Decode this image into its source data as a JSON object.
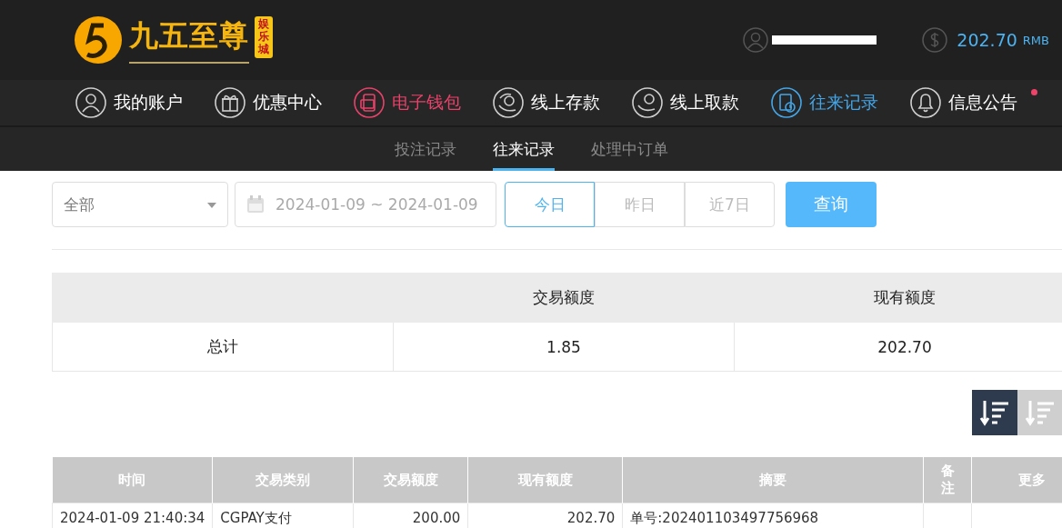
{
  "header": {
    "logo_title": "九五至尊",
    "logo_badge": "娱乐城",
    "balance": "202.70",
    "currency": "RMB"
  },
  "nav": [
    {
      "label": "我的账户",
      "color": "#ffffff",
      "dot": false
    },
    {
      "label": "优惠中心",
      "color": "#ffffff",
      "dot": false
    },
    {
      "label": "电子钱包",
      "color": "#e8426a",
      "dot": false
    },
    {
      "label": "线上存款",
      "color": "#ffffff",
      "dot": false
    },
    {
      "label": "线上取款",
      "color": "#ffffff",
      "dot": false
    },
    {
      "label": "往来记录",
      "color": "#44a6e8",
      "dot": false
    },
    {
      "label": "信息公告",
      "color": "#ffffff",
      "dot": true
    }
  ],
  "subtabs": [
    {
      "label": "投注记录",
      "selected": false
    },
    {
      "label": "往来记录",
      "selected": true
    },
    {
      "label": "处理中订单",
      "selected": false
    }
  ],
  "filter": {
    "type_select": "全部",
    "date_range": "2024-01-09 ~ 2024-01-09",
    "quick": [
      {
        "label": "今日",
        "selected": true
      },
      {
        "label": "昨日",
        "selected": false
      },
      {
        "label": "近7日",
        "selected": false
      }
    ],
    "query_button": "查询"
  },
  "summary": {
    "columns": [
      "交易额度",
      "现有额度"
    ],
    "row": {
      "label": "总计",
      "values": [
        "1.85",
        "202.70"
      ]
    }
  },
  "sort_buttons": [
    {
      "selected": true
    },
    {
      "selected": false
    }
  ],
  "table": {
    "columns": [
      "时间",
      "交易类别",
      "交易额度",
      "现有额度",
      "摘要",
      "备注",
      "更多"
    ],
    "rows": [
      [
        "2024-01-09 21:40:34",
        "CGPAY支付",
        "200.00",
        "202.70",
        "单号:202401103497756968",
        "",
        ""
      ]
    ]
  }
}
